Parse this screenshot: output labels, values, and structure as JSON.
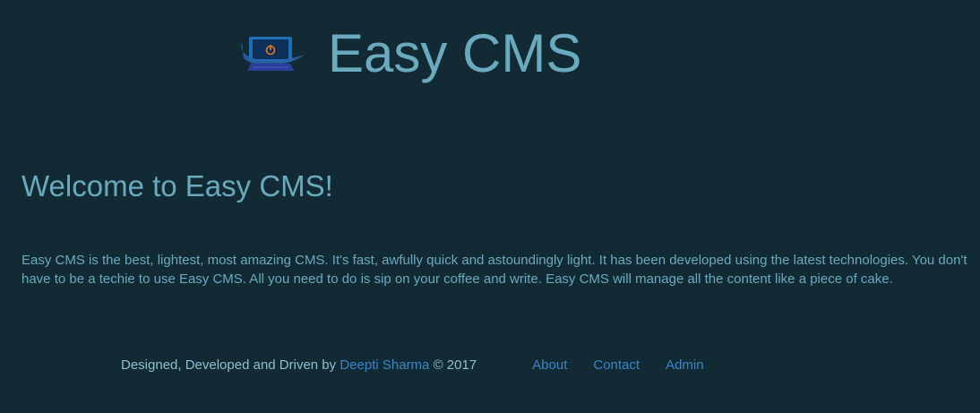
{
  "header": {
    "logo_icon": "laptop-power-icon",
    "title": "Easy CMS"
  },
  "main": {
    "heading": "Welcome to Easy CMS!",
    "intro": "Easy CMS is the best, lightest, most amazing CMS. It's fast, awfully quick and astoundingly light. It has been developed using the latest technologies. You don't have to be a techie to use Easy CMS. All you need to do is sip on your coffee and write. Easy CMS will manage all the content like a piece of cake."
  },
  "footer": {
    "credit_prefix": "Designed, Developed and Driven by",
    "author": "Deepti Sharma",
    "credit_suffix": "© 2017",
    "nav": {
      "about": "About",
      "contact": "Contact",
      "admin": "Admin"
    }
  },
  "colors": {
    "background": "#122a34",
    "text": "#6aaabf",
    "link": "#3a86c8",
    "logo_accent": "#e07a28"
  }
}
